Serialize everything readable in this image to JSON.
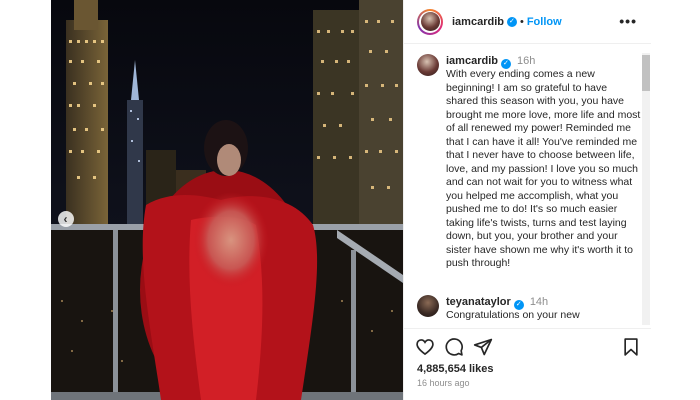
{
  "post": {
    "header": {
      "username": "iamcardib",
      "verified_mark": "✓",
      "separator": "•",
      "follow_label": "Follow",
      "more_icon": "more-horizontal-icon"
    },
    "caption": {
      "username": "iamcardib",
      "time": "16h",
      "text": "With every ending comes a new beginning! I am so grateful to have shared this season with you, you have brought me more love, more life and most of all renewed my power! Reminded me that I can have it all! You've reminded me that I never have to choose between life, love, and my passion! I love you so much and can not wait for you to witness what you helped me accomplish, what you pushed me to do! It's so much easier taking life's twists, turns and test laying down, but you, your brother and your sister have shown me why it's worth it to push through!"
    },
    "comments": [
      {
        "username": "teyanataylor",
        "time": "14h",
        "text": "Congratulations on your new"
      }
    ],
    "media": {
      "prev_icon": "chevron-left-icon",
      "prev_glyph": "‹"
    },
    "actions": {
      "like_icon": "heart-icon",
      "comment_icon": "comment-icon",
      "share_icon": "share-icon",
      "save_icon": "bookmark-icon"
    },
    "likes": "4,885,654 likes",
    "timestamp": "16 hours ago",
    "colors": {
      "accent": "#0095f6",
      "text": "#262626",
      "muted": "#8e8e8e",
      "dress": "#c8141c"
    }
  }
}
